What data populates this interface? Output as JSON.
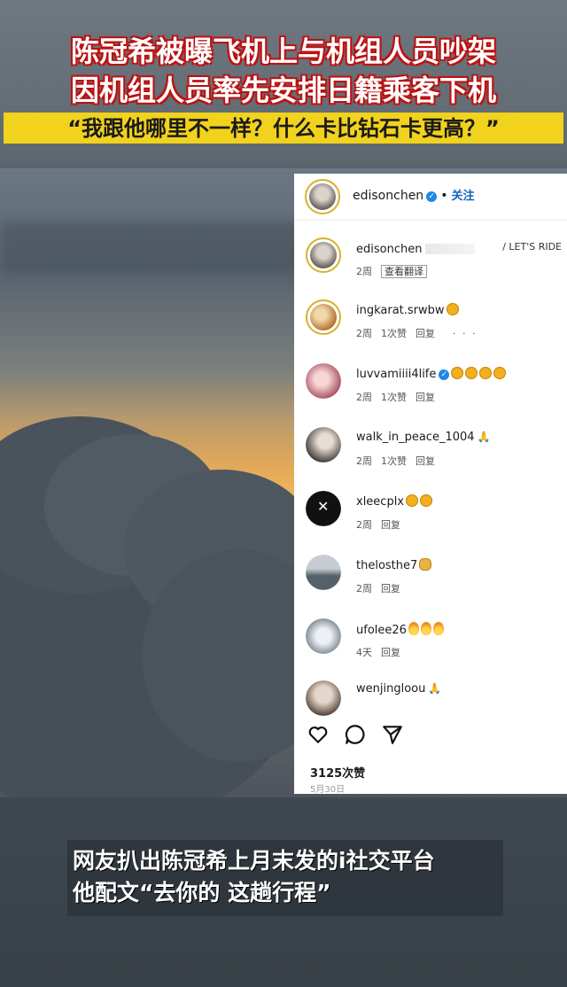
{
  "headline": {
    "line1": "陈冠希被曝飞机上与机组人员吵架",
    "line2": "因机组人员率先安排日籍乘客下机",
    "line3": "“我跟他哪里不一样？什么卡比钻石卡更高？”"
  },
  "post": {
    "username": "edisonchen",
    "follow_label": "关注",
    "verified_icon": "verified-badge-icon",
    "caption": {
      "username": "edisonchen",
      "text_tail": "/ LET'S RIDE",
      "time": "2周",
      "see_translation": "查看翻译"
    },
    "comments": [
      {
        "user": "ingkarat.srwbw",
        "emoji": [
          "smile-emoji"
        ],
        "time": "2周",
        "likes": "1次赞",
        "reply": "回复",
        "more": "· · ·"
      },
      {
        "user": "luvvamiiii4life",
        "verified": true,
        "emoji": [
          "smile-emoji",
          "smile-emoji",
          "smile-emoji",
          "smile-emoji"
        ],
        "time": "2周",
        "likes": "1次赞",
        "reply": "回复"
      },
      {
        "user": "walk_in_peace_1004",
        "emoji": [
          "hands-emoji"
        ],
        "time": "2周",
        "likes": "1次赞",
        "reply": "回复"
      },
      {
        "user": "xleecplx",
        "emoji": [
          "smile-emoji",
          "smile-emoji"
        ],
        "time": "2周",
        "reply": "回复"
      },
      {
        "user": "thelosthe7",
        "emoji": [
          "clap-emoji"
        ],
        "time": "2周",
        "reply": "回复"
      },
      {
        "user": "ufolee26",
        "emoji": [
          "fire-emoji",
          "fire-emoji",
          "fire-emoji"
        ],
        "time": "4天",
        "reply": "回复"
      },
      {
        "user": "wenjingloou",
        "emoji": [
          "hands-emoji"
        ]
      }
    ],
    "likes_count": "3125次赞",
    "date": "5月30日"
  },
  "subtitle": {
    "line1": "网友扒出陈冠希上月末发的i社交平台",
    "line2": "他配文“去你的 这趟行程”"
  },
  "colors": {
    "headline_red": "#c21313",
    "banner_yellow": "#f1d21c",
    "ig_blue": "#1565c0"
  }
}
